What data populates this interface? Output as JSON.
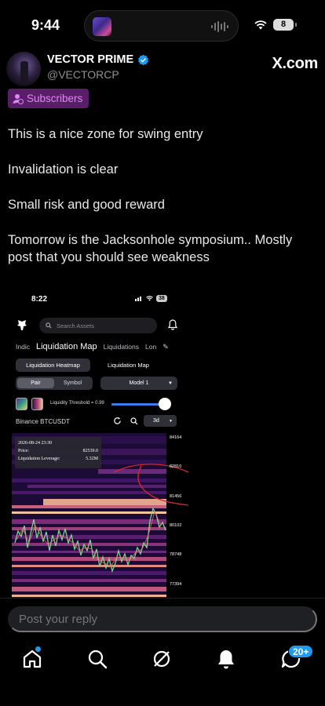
{
  "status_bar": {
    "time": "9:44",
    "battery": "8"
  },
  "author": {
    "name": "VECTOR PRIME",
    "handle": "@VECTORCP",
    "site": "X.com"
  },
  "badge": {
    "label": "Subscribers"
  },
  "post": {
    "lines": [
      "This is a nice zone for swing entry",
      "Invalidation is clear",
      "Small risk and good reward",
      "Tomorrow is the Jacksonhole symposium.. Mostly post that you should see weakness"
    ]
  },
  "embed": {
    "time": "8:22",
    "battery": "38",
    "search_placeholder": "Search Assets",
    "tabs": [
      "Indic",
      "Liquidation Map",
      "Liquidations",
      "Lon"
    ],
    "buttons": {
      "heatmap": "Liquidation Heatmap",
      "map": "Liquidation Map"
    },
    "segment": [
      "Pair",
      "Symbol"
    ],
    "model": "Model 1",
    "threshold_label": "Liquidity Threshold = 0.99",
    "threshold_value": 0.99,
    "pair": "Binance BTCUSDT",
    "range": "3d",
    "tooltip": {
      "date": "2026-08-24 23:30",
      "price_label": "Price:",
      "price": "82539.0",
      "leverage_label": "Liquidation Leverage:",
      "leverage": "5.32M"
    },
    "y_ticks": [
      "84164",
      "82810",
      "81456",
      "80102",
      "78748",
      "77394"
    ]
  },
  "reply": {
    "placeholder": "Post your reply"
  },
  "nav": {
    "notifications_badge": "20+"
  },
  "colors": {
    "accent": "#1d9bf0",
    "badge_bg": "#5a1d6a",
    "badge_fg": "#d98cf0",
    "verified": "#1d9bf0"
  }
}
